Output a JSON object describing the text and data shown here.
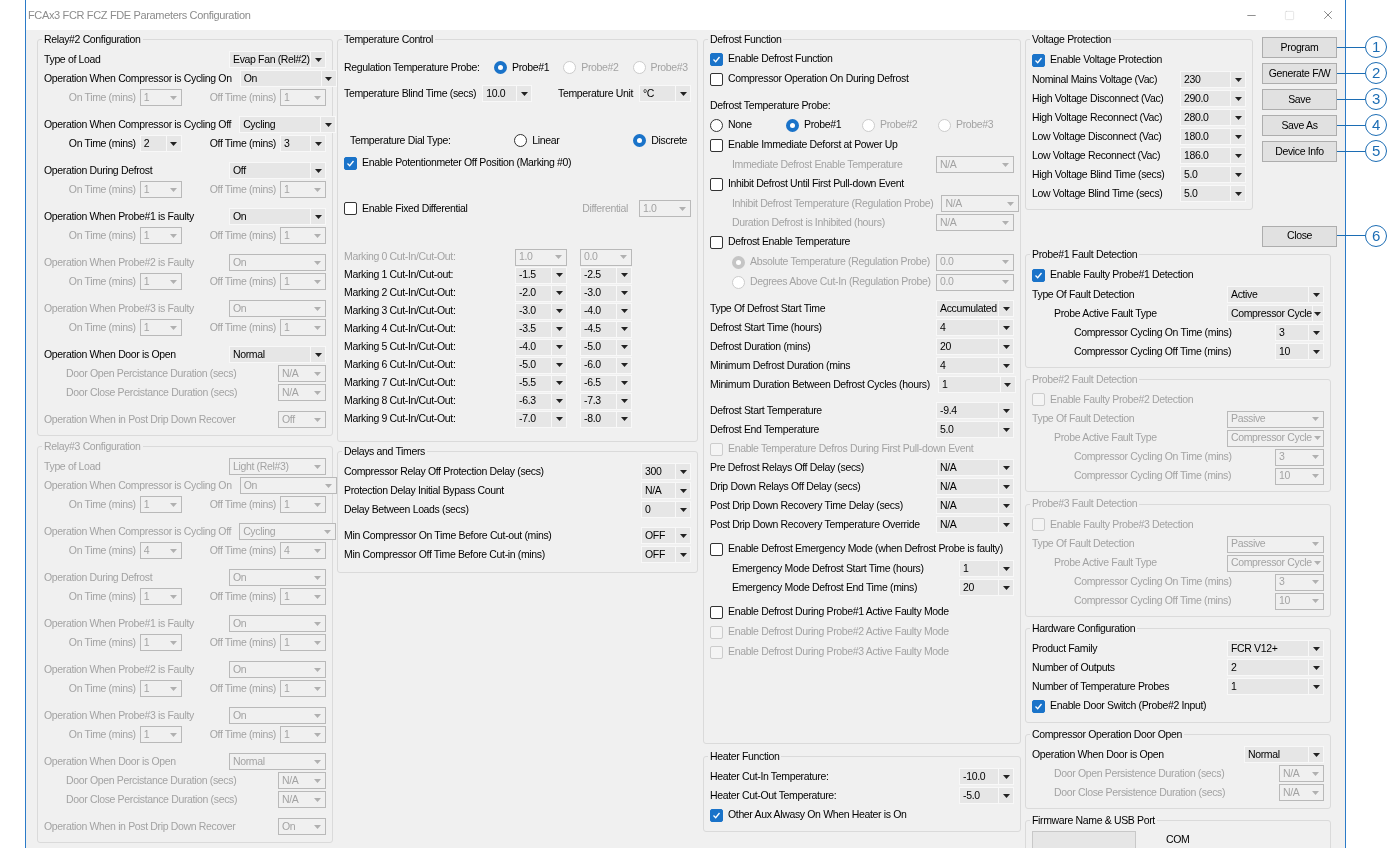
{
  "window": {
    "title": "FCAx3 FCR FCZ FDE Parameters Configuration"
  },
  "relay2": {
    "title": "Relay#2 Configuration",
    "disabled": false,
    "blocks": [
      [
        {
          "kind": "select",
          "label": "Type of Load",
          "value": "Evap Fan (Rel#2)",
          "disabled": false
        },
        {
          "kind": "select",
          "label": "Operation When Compressor is Cycling On",
          "value": "On",
          "disabled": false,
          "children": [
            {
              "kind": "pair",
              "on_label": "On Time (mins)",
              "on_value": "1",
              "off_label": "Off Time (mins)",
              "off_value": "1",
              "disabled": true
            }
          ]
        }
      ],
      [
        {
          "kind": "select",
          "label": "Operation When Compressor is Cycling Off",
          "value": "Cycling",
          "disabled": false,
          "children": [
            {
              "kind": "pair",
              "on_label": "On Time (mins)",
              "on_value": "2",
              "off_label": "Off Time (mins)",
              "off_value": "3",
              "disabled": false
            }
          ]
        }
      ],
      [
        {
          "kind": "select",
          "label": "Operation During Defrost",
          "value": "Off",
          "disabled": false,
          "children": [
            {
              "kind": "pair",
              "on_label": "On Time (mins)",
              "on_value": "1",
              "off_label": "Off Time (mins)",
              "off_value": "1",
              "disabled": true
            }
          ]
        }
      ],
      [
        {
          "kind": "select",
          "label": "Operation When Probe#1 is Faulty",
          "value": "On",
          "disabled": false,
          "children": [
            {
              "kind": "pair",
              "on_label": "On Time (mins)",
              "on_value": "1",
              "off_label": "Off Time (mins)",
              "off_value": "1",
              "disabled": true
            }
          ]
        }
      ],
      [
        {
          "kind": "select",
          "label": "Operation When Probe#2 is Faulty",
          "value": "On",
          "disabled": true,
          "children": [
            {
              "kind": "pair",
              "on_label": "On Time (mins)",
              "on_value": "1",
              "off_label": "Off Time (mins)",
              "off_value": "1",
              "disabled": true
            }
          ]
        }
      ],
      [
        {
          "kind": "select",
          "label": "Operation When Probe#3 is Faulty",
          "value": "On",
          "disabled": true,
          "children": [
            {
              "kind": "pair",
              "on_label": "On Time (mins)",
              "on_value": "1",
              "off_label": "Off Time (mins)",
              "off_value": "1",
              "disabled": true
            }
          ]
        }
      ],
      [
        {
          "kind": "select",
          "label": "Operation When Door is Open",
          "value": "Normal",
          "disabled": false,
          "children": [
            {
              "kind": "short_select",
              "label": "Door Open Percistance Duration (secs)",
              "value": "N/A",
              "disabled": true
            },
            {
              "kind": "short_select",
              "label": "Door Close Percistance Duration (secs)",
              "value": "N/A",
              "disabled": true
            }
          ]
        }
      ],
      [
        {
          "kind": "short_select",
          "label": "Operation When in Post Drip Down Recover",
          "value": "Off",
          "disabled": true
        }
      ]
    ]
  },
  "relay3": {
    "title": "Relay#3 Configuration",
    "disabled": true,
    "blocks": [
      [
        {
          "kind": "select",
          "label": "Type of Load",
          "value": "Light (Rel#3)",
          "disabled": true
        },
        {
          "kind": "select",
          "label": "Operation When Compressor is Cycling On",
          "value": "On",
          "disabled": true,
          "children": [
            {
              "kind": "pair",
              "on_label": "On Time (mins)",
              "on_value": "1",
              "off_label": "Off Time (mins)",
              "off_value": "1",
              "disabled": true
            }
          ]
        }
      ],
      [
        {
          "kind": "select",
          "label": "Operation When Compressor is Cycling Off",
          "value": "Cycling",
          "disabled": true,
          "children": [
            {
              "kind": "pair",
              "on_label": "On Time (mins)",
              "on_value": "4",
              "off_label": "Off Time (mins)",
              "off_value": "4",
              "disabled": true
            }
          ]
        }
      ],
      [
        {
          "kind": "select",
          "label": "Operation During Defrost",
          "value": "On",
          "disabled": true,
          "children": [
            {
              "kind": "pair",
              "on_label": "On Time (mins)",
              "on_value": "1",
              "off_label": "Off Time (mins)",
              "off_value": "1",
              "disabled": true
            }
          ]
        }
      ],
      [
        {
          "kind": "select",
          "label": "Operation When Probe#1 is Faulty",
          "value": "On",
          "disabled": true,
          "children": [
            {
              "kind": "pair",
              "on_label": "On Time (mins)",
              "on_value": "1",
              "off_label": "Off Time (mins)",
              "off_value": "1",
              "disabled": true
            }
          ]
        }
      ],
      [
        {
          "kind": "select",
          "label": "Operation When Probe#2 is Faulty",
          "value": "On",
          "disabled": true,
          "children": [
            {
              "kind": "pair",
              "on_label": "On Time (mins)",
              "on_value": "1",
              "off_label": "Off Time (mins)",
              "off_value": "1",
              "disabled": true
            }
          ]
        }
      ],
      [
        {
          "kind": "select",
          "label": "Operation When Probe#3 is Faulty",
          "value": "On",
          "disabled": true,
          "children": [
            {
              "kind": "pair",
              "on_label": "On Time (mins)",
              "on_value": "1",
              "off_label": "Off Time (mins)",
              "off_value": "1",
              "disabled": true
            }
          ]
        }
      ],
      [
        {
          "kind": "select",
          "label": "Operation When Door is Open",
          "value": "Normal",
          "disabled": true,
          "children": [
            {
              "kind": "short_select",
              "label": "Door Open Percistance Duration (secs)",
              "value": "N/A",
              "disabled": true
            },
            {
              "kind": "short_select",
              "label": "Door Close Percistance Duration (secs)",
              "value": "N/A",
              "disabled": true
            }
          ]
        }
      ],
      [
        {
          "kind": "short_select",
          "label": "Operation When in Post Drip Down Recover",
          "value": "On",
          "disabled": true
        }
      ]
    ]
  },
  "temperature_control": {
    "title": "Temperature Control",
    "disabled": false,
    "regulation_probe": {
      "label": "Regulation Temperature Probe:",
      "options": [
        {
          "label": "Probe#1",
          "selected": true,
          "disabled": false
        },
        {
          "label": "Probe#2",
          "selected": false,
          "disabled": true
        },
        {
          "label": "Probe#3",
          "selected": false,
          "disabled": true
        }
      ]
    },
    "blind_time": {
      "label": "Temperature Blind Time (secs)",
      "value": "10.0"
    },
    "unit": {
      "label": "Temperature Unit",
      "value": "°C"
    },
    "dial_type": {
      "label": "Temperature Dial Type:",
      "options": [
        {
          "label": "Linear",
          "selected": false,
          "disabled": false
        },
        {
          "label": "Discrete",
          "selected": true,
          "disabled": false
        }
      ]
    },
    "potentiometer_off": {
      "label": "Enable Potentionmeter Off Position (Marking #0)",
      "checked": true
    },
    "fixed_differential": {
      "label": "Enable Fixed Differential",
      "checked": false,
      "field_label": "Differential",
      "field_value": "1.0",
      "field_disabled": true
    },
    "markings": [
      {
        "label": "Marking 0 Cut-In/Cut-Out:",
        "cut_in": "1.0",
        "cut_out": "0.0",
        "disabled": true
      },
      {
        "label": "Marking 1 Cut-In/Cut-out:",
        "cut_in": "-1.5",
        "cut_out": "-2.5",
        "disabled": false
      },
      {
        "label": "Marking 2 Cut-In/Cut-Out:",
        "cut_in": "-2.0",
        "cut_out": "-3.0",
        "disabled": false
      },
      {
        "label": "Marking 3 Cut-In/Cut-Out:",
        "cut_in": "-3.0",
        "cut_out": "-4.0",
        "disabled": false
      },
      {
        "label": "Marking 4 Cut-In/Cut-Out:",
        "cut_in": "-3.5",
        "cut_out": "-4.5",
        "disabled": false
      },
      {
        "label": "Marking 5 Cut-In/Cut-Out:",
        "cut_in": "-4.0",
        "cut_out": "-5.0",
        "disabled": false
      },
      {
        "label": "Marking 6 Cut-In/Cut-Out:",
        "cut_in": "-5.0",
        "cut_out": "-6.0",
        "disabled": false
      },
      {
        "label": "Marking 7 Cut-In/Cut-Out:",
        "cut_in": "-5.5",
        "cut_out": "-6.5",
        "disabled": false
      },
      {
        "label": "Marking 8 Cut-In/Cut-Out:",
        "cut_in": "-6.3",
        "cut_out": "-7.3",
        "disabled": false
      },
      {
        "label": "Marking 9 Cut-In/Cut-Out:",
        "cut_in": "-7.0",
        "cut_out": "-8.0",
        "disabled": false
      }
    ]
  },
  "delays": {
    "title": "Delays and Timers",
    "disabled": false,
    "blocks": [
      [
        {
          "kind": "short_select",
          "label": "Compressor Relay Off Protection Delay (secs)",
          "value": "300",
          "disabled": false
        },
        {
          "kind": "short_select",
          "label": "Protection Delay Initial Bypass Count",
          "value": "N/A",
          "disabled": false
        },
        {
          "kind": "short_select",
          "label": "Delay Between Loads (secs)",
          "value": "0",
          "disabled": false
        }
      ],
      [
        {
          "kind": "short_select",
          "label": "Min Compressor On Time Before Cut-out (mins)",
          "value": "OFF",
          "disabled": false
        },
        {
          "kind": "short_select",
          "label": "Min Compressor Off Time Before Cut-in (mins)",
          "value": "OFF",
          "disabled": false
        }
      ]
    ]
  },
  "defrost": {
    "title": "Defrost Function",
    "disabled": false,
    "blocks": [
      [
        {
          "kind": "check",
          "label": "Enable Defrost Function",
          "checked": true,
          "disabled": false
        },
        {
          "kind": "check",
          "label": "Compressor Operation On During Defrost",
          "checked": false,
          "disabled": false
        }
      ],
      [
        {
          "kind": "text",
          "label": "Defrost Temperature Probe:",
          "disabled": false
        },
        {
          "kind": "radio",
          "options": [
            {
              "label": "None",
              "selected": false,
              "disabled": false
            },
            {
              "label": "Probe#1",
              "selected": true,
              "disabled": false
            },
            {
              "label": "Probe#2",
              "selected": false,
              "disabled": true
            },
            {
              "label": "Probe#3",
              "selected": false,
              "disabled": true
            }
          ]
        },
        {
          "kind": "check",
          "label": "Enable Immediate Deforst at Power Up",
          "checked": false,
          "disabled": false,
          "children": [
            {
              "kind": "select",
              "label": "Immediate Defrost Enable Temperature",
              "value": "N/A",
              "disabled": true
            }
          ]
        },
        {
          "kind": "check",
          "label": "Inhibit Defrost Until First Pull-down Event",
          "checked": false,
          "disabled": false,
          "children": [
            {
              "kind": "select",
              "label": "Inhibit Defrost Temperature (Regulation Probe)",
              "value": "N/A",
              "disabled": true
            },
            {
              "kind": "select",
              "label": "Duration Defrost is Inhibited (hours)",
              "value": "N/A",
              "disabled": true
            }
          ]
        },
        {
          "kind": "check",
          "label": "Defrost Enable Temperature",
          "checked": false,
          "disabled": false,
          "children": [
            {
              "kind": "radio_select",
              "label": "Absolute Temperature (Regulation Probe)",
              "selected": true,
              "value": "0.0",
              "disabled": true
            },
            {
              "kind": "radio_select",
              "label": "Degrees Above Cut-In (Regulation Probe)",
              "selected": false,
              "value": "0.0",
              "disabled": true
            }
          ]
        }
      ],
      [
        {
          "kind": "select",
          "label": "Type Of Defrost Start Time",
          "value": "Accumulated",
          "disabled": false
        },
        {
          "kind": "select",
          "label": "Defrost Start Time (hours)",
          "value": "4",
          "disabled": false
        },
        {
          "kind": "select",
          "label": "Defrost Duration (mins)",
          "value": "20",
          "disabled": false
        },
        {
          "kind": "select",
          "label": "Minimum Defrost Duration (mins",
          "value": "4",
          "disabled": false
        },
        {
          "kind": "select",
          "label": "Minimum Duration Between Defrost Cycles (hours)",
          "value": "1",
          "disabled": false
        }
      ],
      [
        {
          "kind": "select",
          "label": "Defrost Start Temperature",
          "value": "-9.4",
          "disabled": false
        },
        {
          "kind": "select",
          "label": "Defrost End Temperature",
          "value": "5.0",
          "disabled": false
        },
        {
          "kind": "check",
          "label": "Enable Temperature Defros During First Pull-down Event",
          "checked": false,
          "disabled": true
        }
      ]
    ],
    "lower_blocks": [
      [
        {
          "kind": "select",
          "label": "Pre Defrost Relays Off Delay (secs)",
          "value": "N/A",
          "disabled": false
        },
        {
          "kind": "select",
          "label": "Drip Down Relays Off Delay (secs)",
          "value": "N/A",
          "disabled": false
        },
        {
          "kind": "select",
          "label": "Post Drip Down Recovery Time Delay (secs)",
          "value": "N/A",
          "disabled": false
        },
        {
          "kind": "select",
          "label": "Post Drip Down Recovery Temperature Override",
          "value": "N/A",
          "disabled": false
        }
      ],
      [
        {
          "kind": "check",
          "label": "Enable Defrost Emergency Mode (when Defrost Probe is faulty)",
          "checked": false,
          "disabled": false,
          "children": [
            {
              "kind": "short_select",
              "label": "Emergency Mode Defrost Start Time (hours)",
              "value": "1",
              "disabled": false
            },
            {
              "kind": "short_select",
              "label": "Emergency Mode Defrost End Time (mins)",
              "value": "20",
              "disabled": false
            }
          ]
        }
      ],
      [
        {
          "kind": "check",
          "label": "Enable Defrost During Probe#1 Active Faulty Mode",
          "checked": false,
          "disabled": false
        },
        {
          "kind": "check",
          "label": "Enable Defrost During Probe#2 Active Faulty Mode",
          "checked": false,
          "disabled": true
        },
        {
          "kind": "check",
          "label": "Enable Defrost During Probe#3 Active Faulty Mode",
          "checked": false,
          "disabled": true
        }
      ]
    ]
  },
  "heater": {
    "title": "Heater Function",
    "disabled": false,
    "blocks": [
      [
        {
          "kind": "short_select",
          "label": "Heater Cut-In Temperature:",
          "value": "-10.0",
          "disabled": false
        },
        {
          "kind": "short_select",
          "label": "Heater Cut-Out Temperature:",
          "value": "-5.0",
          "disabled": false
        },
        {
          "kind": "check",
          "label": "Other Aux Alwasy On When Heater is On",
          "checked": true,
          "disabled": false
        }
      ]
    ]
  },
  "voltage": {
    "title": "Voltage Protection",
    "disabled": false,
    "blocks": [
      [
        {
          "kind": "check",
          "label": "Enable Voltage Protection",
          "checked": true,
          "disabled": false
        },
        {
          "kind": "select",
          "label": "Nominal Mains Voltage (Vac)",
          "value": "230",
          "disabled": false
        },
        {
          "kind": "select",
          "label": "High Voltage Disconnect (Vac)",
          "value": "290.0",
          "disabled": false
        },
        {
          "kind": "select",
          "label": "High Voltage Reconnect (Vac)",
          "value": "280.0",
          "disabled": false
        },
        {
          "kind": "select",
          "label": "Low Voltage Disconnect (Vac)",
          "value": "180.0",
          "disabled": false
        },
        {
          "kind": "select",
          "label": "Low Voltage Reconnect (Vac)",
          "value": "186.0",
          "disabled": false
        },
        {
          "kind": "select",
          "label": "High Voltage Blind Time (secs)",
          "value": "5.0",
          "disabled": false
        },
        {
          "kind": "select",
          "label": "Low Voltage Blind Time (secs)",
          "value": "5.0",
          "disabled": false
        }
      ]
    ]
  },
  "side_buttons": [
    {
      "label": "Program",
      "callout": "1"
    },
    {
      "label": "Generate F/W",
      "callout": "2"
    },
    {
      "label": "Save",
      "callout": "3"
    },
    {
      "label": "Save As",
      "callout": "4"
    },
    {
      "label": "Device Info",
      "callout": "5"
    }
  ],
  "close_button": {
    "label": "Close",
    "callout": "6"
  },
  "probe_faults": [
    {
      "title": "Probe#1 Fault Detection",
      "disabled": false,
      "blocks": [
        [
          {
            "kind": "check",
            "label": "Enable Faulty Probe#1 Detection",
            "checked": true,
            "disabled": false
          },
          {
            "kind": "select",
            "label": "Type Of Fault Detection",
            "value": "Active",
            "disabled": false,
            "children": [
              {
                "kind": "select",
                "label": "Probe Active Fault Type",
                "value": "Compressor Cycle",
                "disabled": false,
                "children": [
                  {
                    "kind": "short_select",
                    "label": "Compressor Cycling On Time (mins)",
                    "value": "3",
                    "disabled": false
                  },
                  {
                    "kind": "short_select",
                    "label": "Compressor Cycling Off Time (mins)",
                    "value": "10",
                    "disabled": false
                  }
                ]
              }
            ]
          }
        ]
      ]
    },
    {
      "title": "Probe#2 Fault Detection",
      "disabled": true,
      "blocks": [
        [
          {
            "kind": "check",
            "label": "Enable Faulty Probe#2 Detection",
            "checked": false,
            "disabled": true
          },
          {
            "kind": "select",
            "label": "Type Of Fault Detection",
            "value": "Passive",
            "disabled": true,
            "children": [
              {
                "kind": "select",
                "label": "Probe Active Fault Type",
                "value": "Compressor Cycle",
                "disabled": true,
                "children": [
                  {
                    "kind": "short_select",
                    "label": "Compressor Cycling On Time (mins)",
                    "value": "3",
                    "disabled": true
                  },
                  {
                    "kind": "short_select",
                    "label": "Compressor Cycling Off Time (mins)",
                    "value": "10",
                    "disabled": true
                  }
                ]
              }
            ]
          }
        ]
      ]
    },
    {
      "title": "Probe#3 Fault Detection",
      "disabled": true,
      "blocks": [
        [
          {
            "kind": "check",
            "label": "Enable Faulty Probe#3 Detection",
            "checked": false,
            "disabled": true
          },
          {
            "kind": "select",
            "label": "Type Of Fault Detection",
            "value": "Passive",
            "disabled": true,
            "children": [
              {
                "kind": "select",
                "label": "Probe Active Fault Type",
                "value": "Compressor Cycle",
                "disabled": true,
                "children": [
                  {
                    "kind": "short_select",
                    "label": "Compressor Cycling On Time (mins)",
                    "value": "3",
                    "disabled": true
                  },
                  {
                    "kind": "short_select",
                    "label": "Compressor Cycling Off Time (mins)",
                    "value": "10",
                    "disabled": true
                  }
                ]
              }
            ]
          }
        ]
      ]
    }
  ],
  "hardware": {
    "title": "Hardware Configuration",
    "disabled": false,
    "blocks": [
      [
        {
          "kind": "select",
          "label": "Product Family",
          "value": "FCR V12+",
          "disabled": false
        },
        {
          "kind": "select",
          "label": "Number of Outputs",
          "value": "2",
          "disabled": false
        },
        {
          "kind": "select",
          "label": "Number of Temperature Probes",
          "value": "1",
          "disabled": false
        },
        {
          "kind": "check",
          "label": "Enable Door Switch (Probe#2 Input)",
          "checked": true,
          "disabled": false
        }
      ]
    ]
  },
  "door": {
    "title": "Compressor Operation Door Open",
    "disabled": false,
    "blocks": [
      [
        {
          "kind": "select",
          "label": "Operation When Door is Open",
          "value": "Normal",
          "disabled": false,
          "children": [
            {
              "kind": "short_select",
              "label": "Door Open Persistence Duration (secs)",
              "value": "N/A",
              "disabled": true
            },
            {
              "kind": "short_select",
              "label": "Door Close Persistence Duration (secs)",
              "value": "N/A",
              "disabled": true
            }
          ]
        }
      ]
    ]
  },
  "firmware": {
    "title": "Firmware Name & USB Port",
    "disabled": false,
    "port": "COM"
  }
}
